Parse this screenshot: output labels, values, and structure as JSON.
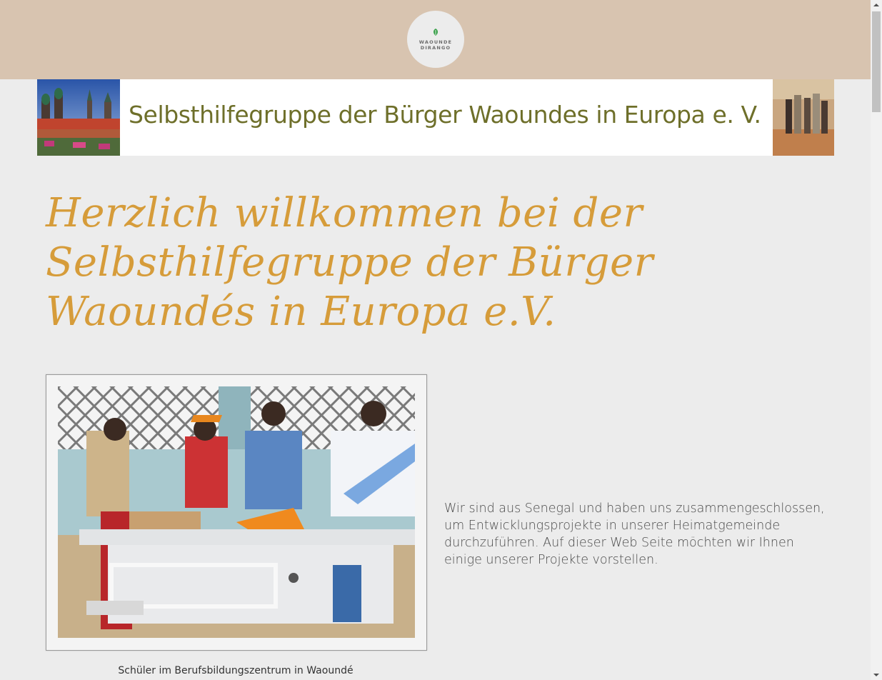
{
  "header": {
    "logo_line1": "WAOUNDE",
    "logo_line2": "DIRANGO",
    "logo_icon": "leaf-icon",
    "background_color": "#d8c4b0"
  },
  "banner": {
    "text": "Selbsthilfegruppe der Bürger Waoundes in Europa e. V.",
    "text_color": "#6e6f2a"
  },
  "main": {
    "headline": "Herzlich willkommen bei der Selbsthilfegruppe der Bürger Waoundés in Europa e.V.",
    "headline_color": "#d69c3a",
    "photo_caption": "Schüler im Berufsbildungszentrum in Waoundé",
    "intro_text": "Wir sind aus Senegal und haben uns zusammengeschlossen, um Entwicklungsprojekte in unserer Heimatgemeinde durchzuführen. Auf dieser Web Seite möchten wir Ihnen einige unserer Projekte vorstellen."
  }
}
